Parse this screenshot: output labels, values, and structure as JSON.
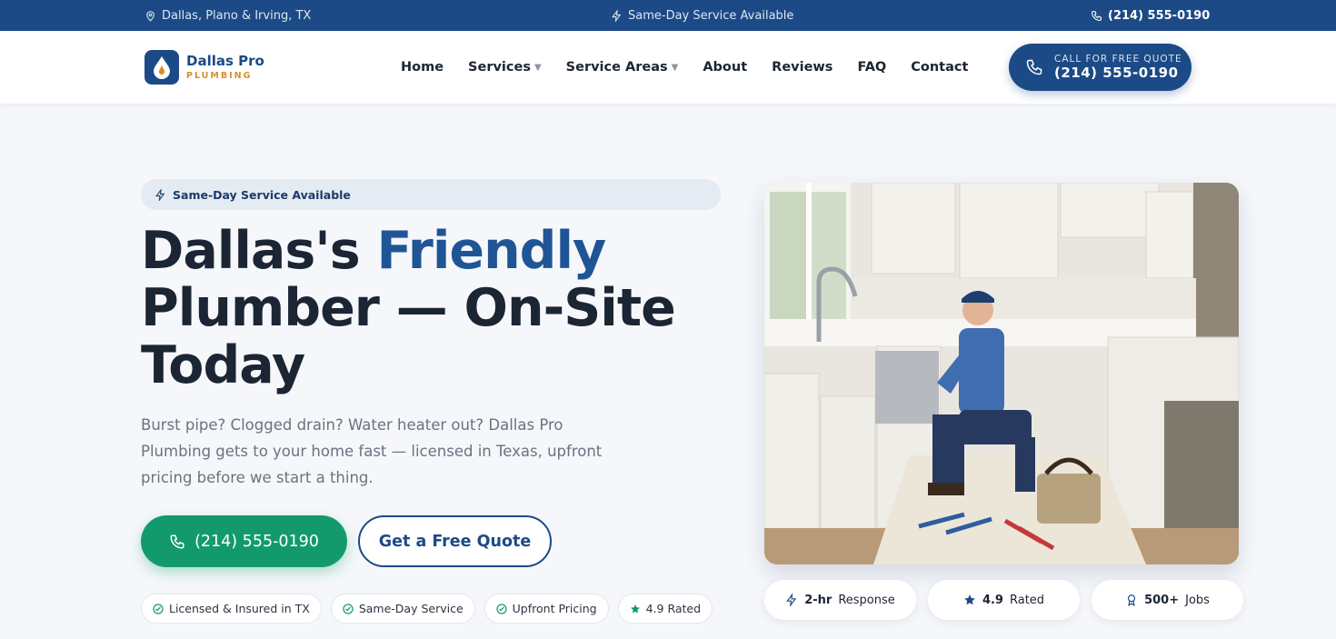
{
  "topbar": {
    "location": "Dallas, Plano & Irving, TX",
    "same_day": "Same-Day Service Available",
    "phone": "(214) 555-0190"
  },
  "header": {
    "logo_name": "Dallas Pro",
    "logo_sub": "PLUMBING",
    "nav": [
      {
        "label": "Home"
      },
      {
        "label": "Services"
      },
      {
        "label": "Service Areas"
      },
      {
        "label": "About"
      },
      {
        "label": "Reviews"
      },
      {
        "label": "FAQ"
      },
      {
        "label": "Contact"
      }
    ],
    "cta_small": "CALL FOR FREE QUOTE",
    "cta_phone": "(214) 555-0190"
  },
  "hero": {
    "pill": "Same-Day Service Available",
    "title_part1": "Dallas's ",
    "title_accent": "Friendly",
    "title_part2": "Plumber — On-Site Today",
    "lede": "Burst pipe? Clogged drain? Water heater out? Dallas Pro Plumbing gets to your home fast — licensed in Texas, upfront pricing before we start a thing.",
    "btn_phone": "(214) 555-0190",
    "btn_quote": "Get a Free Quote",
    "badges": [
      {
        "label": "Licensed & Insured in TX"
      },
      {
        "label": "Same-Day Service"
      },
      {
        "label": "Upfront Pricing"
      },
      {
        "label": "4.9 Rated"
      }
    ]
  },
  "stats": [
    {
      "value": "2-hr",
      "label": "Response"
    },
    {
      "value": "4.9",
      "label": "Rated"
    },
    {
      "value": "500+",
      "label": "Jobs"
    }
  ],
  "colors": {
    "brand": "#1c4a86",
    "accent": "#1f5596",
    "green": "#139a6c",
    "gold": "#d4912a"
  }
}
